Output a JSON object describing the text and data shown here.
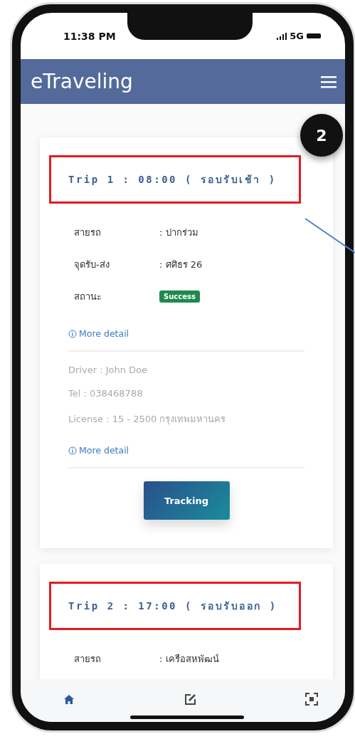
{
  "status_bar": {
    "time": "11:38 PM",
    "network": "5G"
  },
  "header": {
    "title": "eTraveling"
  },
  "annotation": {
    "badge": "2"
  },
  "trips": [
    {
      "title": "Trip 1 : 08:00 ( รอบรับเช้า )",
      "fields": [
        {
          "label": "สายรถ",
          "value": ": ปากร่วม",
          "kind": "text"
        },
        {
          "label": "จุดรับ-ส่ง",
          "value": ": ศศิธร 26",
          "kind": "text"
        },
        {
          "label": "สถานะ",
          "value": "Success",
          "kind": "badge",
          "color": "#1e8a4c"
        }
      ],
      "more_detail": "More detail",
      "driver_lines": [
        "Driver : John Doe",
        "Tel : 038468788",
        "License : 15 - 2500 กรุงเทพมหานคร"
      ],
      "driver_more_detail": "More detail",
      "button": "Tracking"
    },
    {
      "title": "Trip 2 : 17:00 ( รอบรับออก )",
      "fields": [
        {
          "label": "สายรถ",
          "value": ": เครือสหพัฒน์",
          "kind": "text"
        }
      ]
    }
  ],
  "bottom_nav": [
    {
      "kind": "home",
      "selected": true
    },
    {
      "kind": "edit",
      "selected": false
    },
    {
      "kind": "scan",
      "selected": false
    }
  ]
}
